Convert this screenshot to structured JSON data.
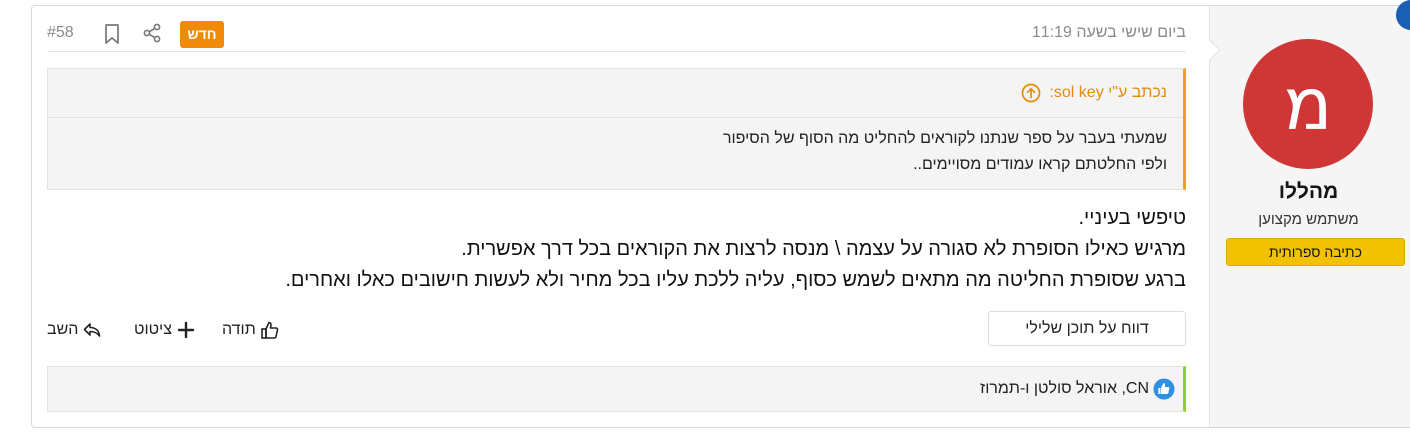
{
  "user": {
    "avatar_letter": "מ",
    "avatar_color": "#cf3636",
    "name": "מהללו",
    "title": "משתמש מקצוען",
    "banner": "כתיבה ספרותית"
  },
  "header": {
    "date": "ביום שישי בשעה 11:19",
    "new_badge": "חדש",
    "post_number": "#58"
  },
  "quote": {
    "attribution": "נכתב ע\"י sol key:",
    "lines": [
      "שמעתי בעבר על ספר שנתנו לקוראים להחליט מה הסוף של הסיפור",
      "ולפי החלטתם קראו עמודים מסויימים.."
    ]
  },
  "message": {
    "lines": [
      "טיפשי בעיניי.",
      "מרגיש כאילו הסופרת לא סגורה על עצמה \\ מנסה לרצות את הקוראים בכל דרך אפשרית.",
      "ברגע שסופרת החליטה מה מתאים לשמש כסוף, עליה ללכת עליו בכל מחיר ולא לעשות חישובים כאלו ואחרים."
    ]
  },
  "actions": {
    "report": "דווח על תוכן שלילי",
    "thanks": "תודה",
    "quote": "ציטוט",
    "reply": "השב"
  },
  "reactions": {
    "text": "CN, אוראל סולטן ו-תמרוז"
  },
  "colors": {
    "accent_orange": "#f08a0a",
    "banner_yellow": "#f2c200",
    "reaction_border": "#8ccf2f",
    "like_blue": "#2f8fe0"
  }
}
